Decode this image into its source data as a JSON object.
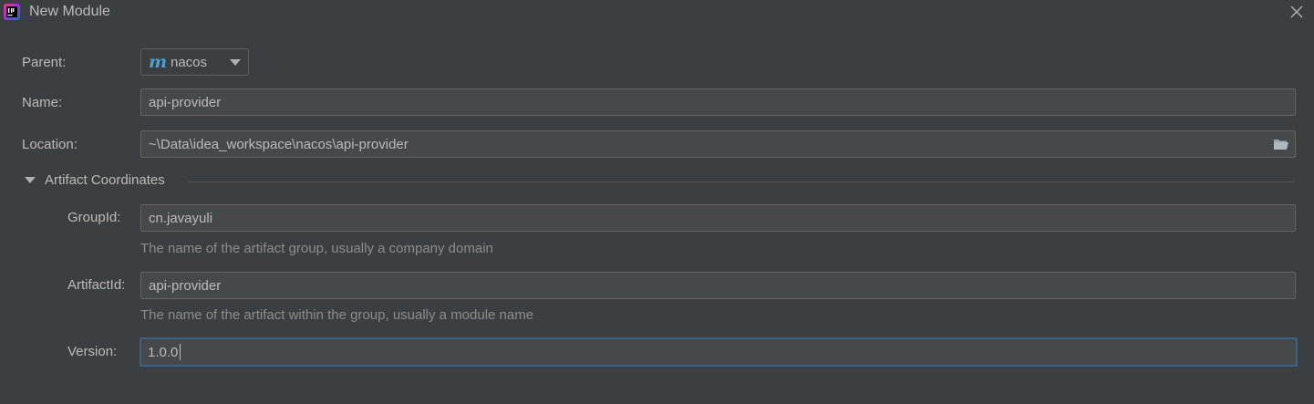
{
  "window": {
    "title": "New Module"
  },
  "icons": {
    "app": "intellij-idea-icon",
    "close": "close-icon",
    "maven": "maven-module-icon",
    "folder": "folder-open-icon",
    "expand": "triangle-down-icon"
  },
  "form": {
    "parent": {
      "label": "Parent:",
      "value": "nacos"
    },
    "name": {
      "label": "Name:",
      "value": "api-provider"
    },
    "location": {
      "label": "Location:",
      "value": "~\\Data\\idea_workspace\\nacos\\api-provider"
    }
  },
  "artifact": {
    "section_title": "Artifact Coordinates",
    "group_id": {
      "label": "GroupId:",
      "value": "cn.javayuli",
      "hint": "The name of the artifact group, usually a company domain"
    },
    "artifact_id": {
      "label": "ArtifactId:",
      "value": "api-provider",
      "hint": "The name of the artifact within the group, usually a module name"
    },
    "version": {
      "label": "Version:",
      "value": "1.0.0"
    }
  },
  "colors": {
    "background": "#3c3f41",
    "field_background": "#45494a",
    "field_border": "#646464",
    "focus_border": "#3d6185",
    "text": "#bbbbbb",
    "hint_text": "#8c8c8c",
    "maven_accent": "#4e9fd1"
  }
}
